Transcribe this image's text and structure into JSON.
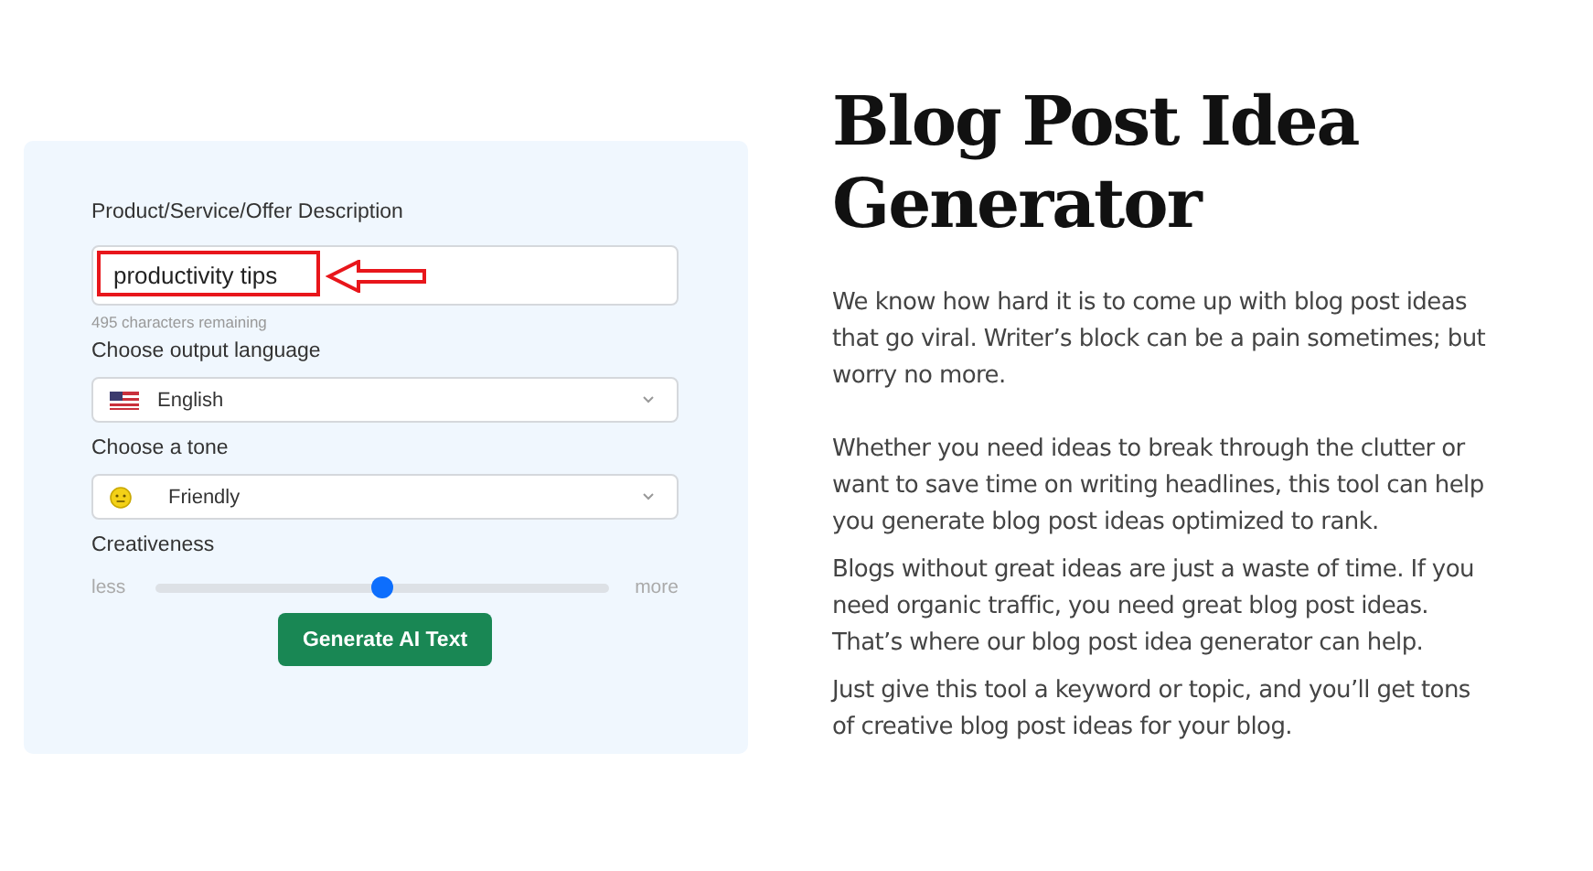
{
  "form": {
    "description_label": "Product/Service/Offer Description",
    "description_value": "productivity tips",
    "chars_remaining": "495 characters remaining",
    "language_label": "Choose output language",
    "language": "English",
    "tone_label": "Choose a tone",
    "tone": "Friendly",
    "creativeness_label": "Creativeness",
    "slider_min": "less",
    "slider_max": "more",
    "creativeness": {
      "level": 0.5
    },
    "button": "Generate AI Text"
  },
  "title": "Blog Post Idea Generator",
  "paragraphs": [
    "We know how hard it is to come up with blog post ideas that go viral. Writer’s block can be a pain sometimes; but worry no more.",
    "Whether you need ideas to break through the clutter or want to save time on writing headlines, this tool can help you generate blog post ideas optimized to rank.",
    "Blogs without great ideas are just a waste of time. If you need organic traffic, you need great blog post ideas. That’s where our blog post idea generator can help.",
    "Just give this tool a keyword or topic, and you’ll get tons of creative blog post ideas for your blog."
  ]
}
